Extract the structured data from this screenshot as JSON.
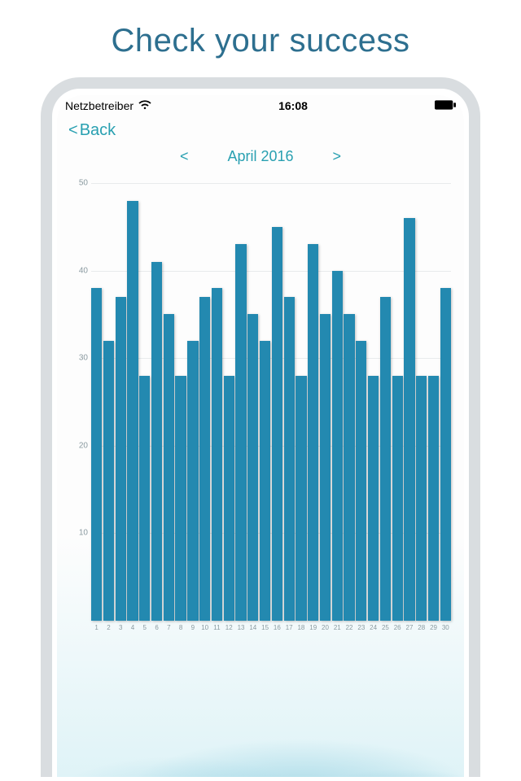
{
  "hero": {
    "title": "Check your success"
  },
  "status_bar": {
    "carrier": "Netzbetreiber",
    "time": "16:08"
  },
  "nav": {
    "back_label": "Back",
    "back_chevron": "<"
  },
  "month_nav": {
    "prev": "<",
    "label": "April 2016",
    "next": ">"
  },
  "colors": {
    "accent": "#29a0b1",
    "bar": "#2389b0"
  },
  "chart_data": {
    "type": "bar",
    "title": "",
    "xlabel": "",
    "ylabel": "",
    "ylim": [
      0,
      50
    ],
    "y_ticks": [
      10,
      20,
      30,
      40,
      50
    ],
    "categories": [
      "1",
      "2",
      "3",
      "4",
      "5",
      "6",
      "7",
      "8",
      "9",
      "10",
      "11",
      "12",
      "13",
      "14",
      "15",
      "16",
      "17",
      "18",
      "19",
      "20",
      "21",
      "22",
      "23",
      "24",
      "25",
      "26",
      "27",
      "28",
      "29",
      "30"
    ],
    "values": [
      38,
      32,
      37,
      48,
      28,
      41,
      35,
      28,
      32,
      37,
      38,
      28,
      43,
      35,
      32,
      45,
      37,
      28,
      43,
      35,
      40,
      35,
      32,
      28,
      37,
      28,
      46,
      28,
      28,
      38
    ]
  }
}
